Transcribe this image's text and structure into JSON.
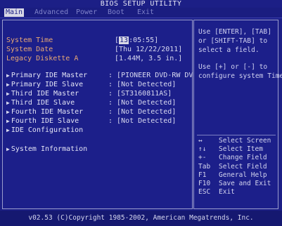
{
  "title": "BIOS SETUP UTILITY",
  "menu": [
    "Main",
    "Advanced",
    "Power",
    "Boot",
    "Exit"
  ],
  "main": {
    "system_time_label": "System Time",
    "system_time_hour": "13",
    "system_time_rest": ":05:55]",
    "system_date_label": "System Date",
    "system_date_value": "[Thu 12/22/2011]",
    "legacy_diskette_label": "Legacy Diskette A",
    "legacy_diskette_value": "[1.44M, 3.5 in.]",
    "drives": [
      {
        "label": "Primary IDE Master",
        "value": "[PIONEER DVD-RW  DV]"
      },
      {
        "label": "Primary IDE Slave",
        "value": "[Not Detected]"
      },
      {
        "label": "Third IDE Master",
        "value": "[ST3160811AS]"
      },
      {
        "label": "Third IDE Slave",
        "value": "[Not Detected]"
      },
      {
        "label": "Fourth IDE Master",
        "value": "[Not Detected]"
      },
      {
        "label": "Fourth IDE Slave",
        "value": "[Not Detected]"
      }
    ],
    "ide_configuration": "IDE Configuration",
    "system_information": "System Information"
  },
  "help": {
    "line1": "Use [ENTER], [TAB]",
    "line2": "or [SHIFT-TAB] to",
    "line3": "select a field.",
    "line4": "Use [+] or [-] to",
    "line5": "configure system Time."
  },
  "keys": [
    {
      "key": "↔",
      "desc": "Select Screen"
    },
    {
      "key": "↑↓",
      "desc": "Select Item"
    },
    {
      "key": "+-",
      "desc": "Change Field"
    },
    {
      "key": "Tab",
      "desc": "Select Field"
    },
    {
      "key": "F1",
      "desc": "General Help"
    },
    {
      "key": "F10",
      "desc": "Save and Exit"
    },
    {
      "key": "ESC",
      "desc": "Exit"
    }
  ],
  "footer": "v02.53 (C)Copyright 1985-2002, American Megatrends, Inc."
}
